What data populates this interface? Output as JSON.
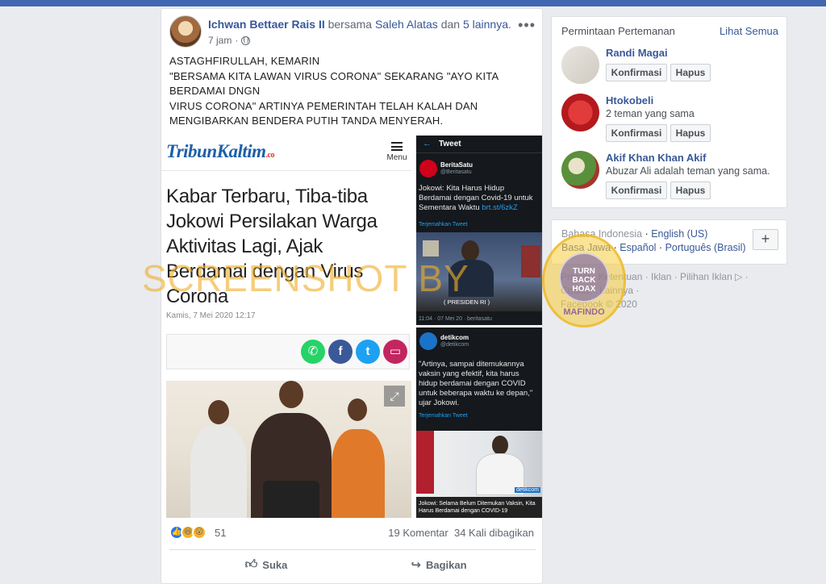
{
  "post": {
    "author": "Ichwan Bettaer Rais II",
    "with_word": "bersama",
    "tagged": "Saleh Alatas",
    "and_word": "dan",
    "others": "5 lainnya",
    "time": "7 jam",
    "more_icon": "more-horizontal-icon",
    "text_lines": [
      "ASTAGHFIRULLAH, KEMARIN",
      "\"BERSAMA KITA LAWAN VIRUS CORONA\" SEKARANG \"AYO KITA",
      "BERDAMAI DNGN",
      "VIRUS CORONA\" ARTINYA PEMERINTAH TELAH KALAH DAN",
      "MENGIBARKAN BENDERA PUTIH TANDA MENYERAH."
    ]
  },
  "article": {
    "site": "TribunKaltim",
    "site_suffix": ".co",
    "menu_label": "Menu",
    "headline_lines": [
      "Kabar Terbaru, Tiba-tiba",
      "Jokowi Persilakan Warga",
      "Aktivitas Lagi, Ajak",
      "Berdamai dengan Virus",
      "Corona"
    ],
    "date": "Kamis, 7 Mei 2020 12:17",
    "share_icons": [
      "whatsapp-icon",
      "facebook-icon",
      "twitter-icon",
      "comment-icon"
    ],
    "share_colors": [
      "#25d366",
      "#3b5998",
      "#1da1f2",
      "#c3265f"
    ]
  },
  "tweet1": {
    "bar_title": "Tweet",
    "name": "BeritaSatu",
    "handle": "@Beritasatu",
    "body_lines": [
      "Jokowi: Kita Harus Hidup",
      "Berdamai dengan Covid-19 untuk",
      "Sementara Waktu "
    ],
    "link": "brt.st/6zkZ",
    "translate": "Terjemahkan Tweet",
    "sign": "( PRESIDEN RI )",
    "meta": "11:04 · 07 Mei 20 · beritasatu"
  },
  "tweet2": {
    "name": "detikcom",
    "handle": "@detikcom",
    "body_lines": [
      "\"Artinya, sampai ditemukannya",
      "vaksin yang efektif, kita harus",
      "hidup berdamai dengan COVID",
      "untuk beberapa waktu ke depan,\"",
      "ujar Jokowi."
    ],
    "translate": "Terjemahkan Tweet",
    "brand": "detikcom",
    "caption_lines": [
      "Jokowi: Selama Belum Ditemukan Vaksin, Kita",
      "Harus Berdamai dengan COVID-19"
    ]
  },
  "reactions": {
    "count": "51",
    "comments": "19 Komentar",
    "shares": "34 Kali dibagikan",
    "like_label": "Suka",
    "share_label": "Bagikan"
  },
  "friends": {
    "title": "Permintaan Pertemanan",
    "see_all": "Lihat Semua",
    "confirm": "Konfirmasi",
    "delete": "Hapus",
    "requests": [
      {
        "name": "Randi Magai",
        "mutual": ""
      },
      {
        "name": "Htokobeli",
        "mutual": "2 teman yang sama"
      },
      {
        "name": "Akif Khan Khan Akif",
        "mutual": "Abuzar Ali adalah teman yang sama."
      }
    ]
  },
  "languages": {
    "line1_current": "Bahasa Indonesia",
    "line1_link": "English (US)",
    "line2": [
      "Basa Jawa",
      "Español",
      "Português (Brasil)"
    ],
    "add_label": "+"
  },
  "footer": {
    "line1": "Privasi · Ketentuan · Iklan · Pilihan Iklan ▷ ·",
    "line2": "Cookie · Lainnya ·",
    "line3": "Facebook © 2020"
  },
  "watermark": {
    "text": "SCREENSHOT BY",
    "seal": "TURN BACK HOAX",
    "seal_ring": "MAFINDO"
  },
  "colors": {
    "fb_blue": "#4267b2",
    "link": "#385898",
    "tweet_bg": "#15181c",
    "watermark": "#f0af28"
  }
}
